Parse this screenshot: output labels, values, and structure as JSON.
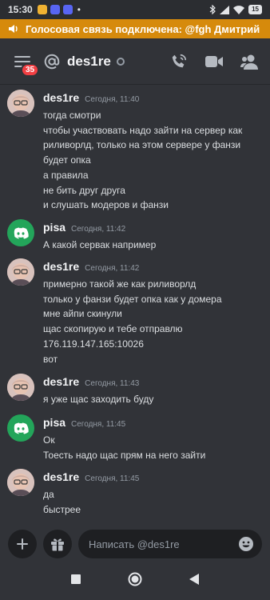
{
  "status_bar": {
    "time": "15:30",
    "battery": "15",
    "app_colors": [
      "#f0b232",
      "#5865f2",
      "#5865f2"
    ]
  },
  "voice_banner": {
    "text": "Голосовая связь подключена: @fgh Дмитрий",
    "color": "#d68a0c"
  },
  "header": {
    "channel_name": "des1re",
    "badge_count": "35"
  },
  "messages": [
    {
      "author": "des1re",
      "avatar": "face",
      "timestamp": "Сегодня, 11:40",
      "lines": [
        "тогда смотри",
        "чтобы участвовать надо зайти на сервер как",
        "риливорлд, только на этом сервере у фанзи",
        "будет опка",
        "а правила",
        "не бить друг друга",
        "и слушать модеров и фанзи"
      ]
    },
    {
      "author": "pisa",
      "avatar": "discord",
      "timestamp": "Сегодня, 11:42",
      "lines": [
        "А какой сервак например"
      ]
    },
    {
      "author": "des1re",
      "avatar": "face",
      "timestamp": "Сегодня, 11:42",
      "lines": [
        "примерно такой же как риливорлд",
        "только у фанзи будет опка как у домера",
        "мне айпи скинули",
        "щас скопирую и тебе отправлю",
        "176.119.147.165:10026",
        "вот"
      ]
    },
    {
      "author": "des1re",
      "avatar": "face",
      "timestamp": "Сегодня, 11:43",
      "lines": [
        "я уже щас заходить буду"
      ]
    },
    {
      "author": "pisa",
      "avatar": "discord",
      "timestamp": "Сегодня, 11:45",
      "lines": [
        "Ок",
        "Тоесть надо щас прям на него зайти"
      ]
    },
    {
      "author": "des1re",
      "avatar": "face",
      "timestamp": "Сегодня, 11:45",
      "lines": [
        "да",
        "быстрее"
      ]
    }
  ],
  "composer": {
    "placeholder": "Написать @des1re"
  },
  "icons": {
    "menu": "hamburger-icon",
    "at": "at-icon",
    "voice_call": "phone-call-icon",
    "video": "video-camera-icon",
    "members": "members-icon",
    "add": "plus-icon",
    "gift": "gift-icon",
    "emoji": "emoji-icon",
    "nav_recent": "square-icon",
    "nav_home": "circle-icon",
    "nav_back": "triangle-back-icon"
  }
}
